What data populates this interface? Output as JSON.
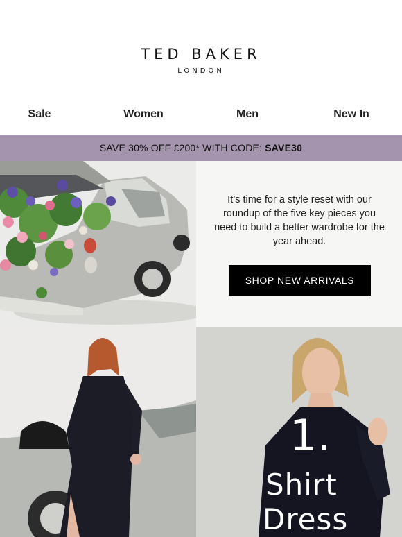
{
  "header": {
    "brand": "TED BAKER",
    "sub": "LONDON"
  },
  "nav": {
    "items": [
      {
        "label": "Sale"
      },
      {
        "label": "Women"
      },
      {
        "label": "Men"
      },
      {
        "label": "New In"
      }
    ]
  },
  "promo": {
    "text": "SAVE 30% OFF £200* WITH CODE: ",
    "code": "SAVE30",
    "bg_color": "#a594ae"
  },
  "hero": {
    "copy": "It’s time for a style reset with our roundup of the five key pieces you need to build a better wardrobe for the year ahead.",
    "cta": "SHOP NEW ARRIVALS"
  },
  "feature": {
    "number": "1.",
    "title_line1": "Shirt",
    "title_line2": "Dress"
  }
}
